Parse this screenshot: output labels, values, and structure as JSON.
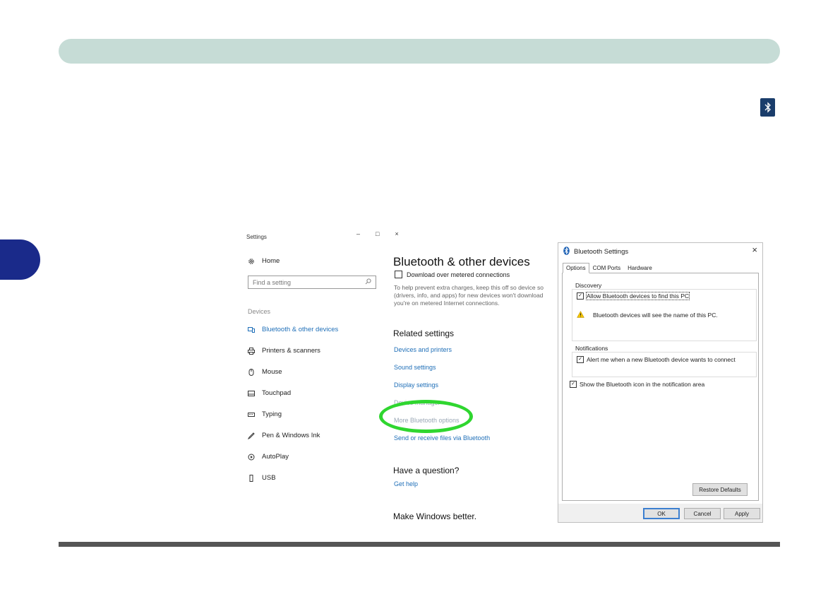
{
  "settings_window": {
    "title": "Settings",
    "home": "Home",
    "search_placeholder": "Find a setting",
    "section": "Devices",
    "nav": [
      {
        "label": "Bluetooth & other devices",
        "icon": "bluetooth-devices-icon",
        "active": true
      },
      {
        "label": "Printers & scanners",
        "icon": "printer-icon",
        "active": false
      },
      {
        "label": "Mouse",
        "icon": "mouse-icon",
        "active": false
      },
      {
        "label": "Touchpad",
        "icon": "touchpad-icon",
        "active": false
      },
      {
        "label": "Typing",
        "icon": "keyboard-icon",
        "active": false
      },
      {
        "label": "Pen & Windows Ink",
        "icon": "pen-icon",
        "active": false
      },
      {
        "label": "AutoPlay",
        "icon": "autoplay-icon",
        "active": false
      },
      {
        "label": "USB",
        "icon": "usb-icon",
        "active": false
      }
    ],
    "main": {
      "title": "Bluetooth & other devices",
      "metered_checkbox": "Download over metered connections",
      "metered_desc": [
        "To help prevent extra charges, keep this off so device so",
        "(drivers, info, and apps) for new devices won't download",
        "you're on metered Internet connections."
      ],
      "related_heading": "Related settings",
      "related_links": [
        "Devices and printers",
        "Sound settings",
        "Display settings",
        "Device manager",
        "More Bluetooth options",
        "Send or receive files via Bluetooth"
      ],
      "question_heading": "Have a question?",
      "help_link": "Get help",
      "better_heading": "Make Windows better."
    }
  },
  "bluetooth_dialog": {
    "title": "Bluetooth Settings",
    "tabs": [
      "Options",
      "COM Ports",
      "Hardware"
    ],
    "discovery_label": "Discovery",
    "allow_find": "Allow Bluetooth devices to find this PC",
    "warning_text": "Bluetooth devices will see the name of this PC.",
    "notifications_label": "Notifications",
    "alert_new": "Alert me when a new Bluetooth device wants to connect",
    "show_icon": "Show the Bluetooth icon in the notification area",
    "restore_defaults": "Restore Defaults",
    "ok": "OK",
    "cancel": "Cancel",
    "apply": "Apply"
  },
  "colors": {
    "header_bar": "#c6dcd6",
    "side_tab": "#1a2a8a",
    "link_blue": "#1f6fb8",
    "highlight_green": "#2fd62f"
  }
}
